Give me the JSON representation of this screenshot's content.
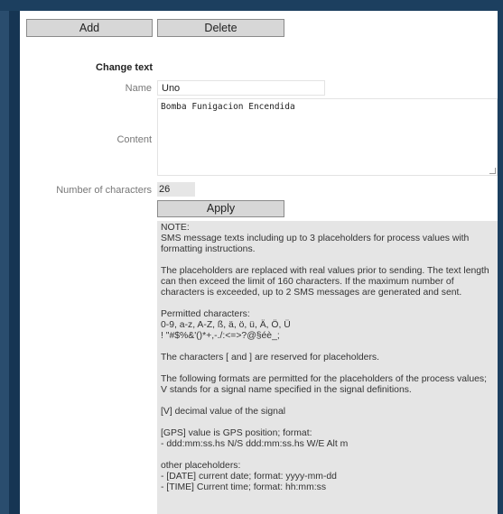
{
  "toolbar": {
    "add_label": "Add",
    "delete_label": "Delete"
  },
  "form": {
    "section_title": "Change text",
    "name_label": "Name",
    "name_value": "Uno",
    "content_label": "Content",
    "content_value": "Bomba Funigacion Encendida",
    "count_label": "Number of characters",
    "count_value": "26",
    "apply_label": "Apply"
  },
  "note": {
    "heading": "NOTE:",
    "intro": "SMS message texts including up to 3 placeholders for process values with formatting instructions.",
    "placeholders_info": "The placeholders are replaced with real values prior to sending. The text length can then exceed the limit of 160 characters. If the maximum number of characters is exceeded, up to 2 SMS messages are generated and sent.",
    "permitted_title": "Permitted characters:",
    "permitted_line1": "0-9, a-z, A-Z, ß, ä, ö, ü, Ä, Ö, Ü",
    "permitted_line2": "! \"#$%&'()*+,-./:<=>?@§éè_;",
    "reserved": "The characters [ and ] are reserved for placeholders.",
    "formats": "The following formats are permitted for the placeholders of the process values; V stands for a signal name specified in the signal definitions.",
    "v_format": "[V] decimal value of the signal",
    "gps_line1": "[GPS] value is GPS position; format:",
    "gps_line2": "- ddd:mm:ss.hs N/S ddd:mm:ss.hs W/E Alt m",
    "other_title": "other placeholders:",
    "date_line": "- [DATE] current date; format: yyyy-mm-dd",
    "time_line": "- [TIME] Current time; format: hh:mm:ss"
  }
}
